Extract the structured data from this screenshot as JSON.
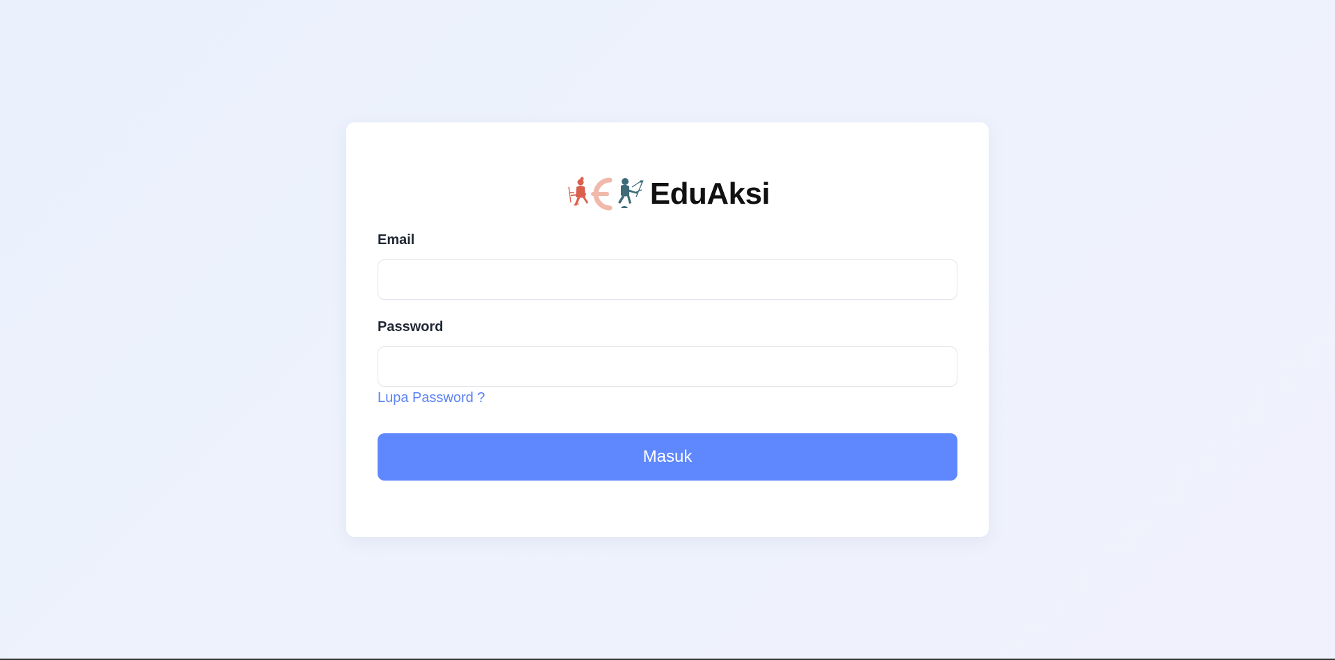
{
  "brand": {
    "name": "EduAksi",
    "logo_icon": "eduaksi-logo-icon",
    "colors": {
      "red": "#d9604e",
      "pink": "#f0b9ab",
      "teal": "#3d6b78"
    }
  },
  "form": {
    "email_label": "Email",
    "email_value": "",
    "email_placeholder": "",
    "password_label": "Password",
    "password_value": "",
    "password_placeholder": "",
    "forgot_password_link": "Lupa Password ?",
    "submit_label": "Masuk"
  },
  "colors": {
    "accent": "#5f88fe",
    "link": "#5d83f5",
    "background": "#ecf1fc",
    "card": "#ffffff"
  }
}
